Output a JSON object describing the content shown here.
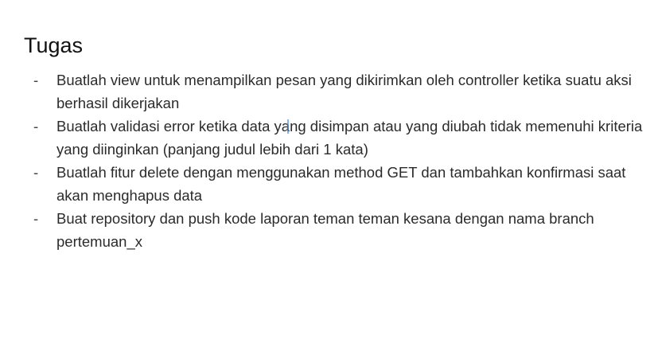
{
  "slide": {
    "title": "Tugas",
    "bullet_symbol": "-",
    "tasks": [
      {
        "text": "Buatlah view untuk menampilkan pesan yang dikirimkan oleh controller ketika suatu aksi berhasil dikerjakan"
      },
      {
        "text": "Buatlah validasi error ketika data yang disimpan atau yang diubah tidak memenuhi kriteria yang diinginkan (panjang judul lebih dari 1 kata)"
      },
      {
        "text": "Buatlah fitur delete dengan menggunakan method GET dan tambahkan konfirmasi saat akan menghapus data"
      },
      {
        "text": "Buat repository dan push kode laporan teman teman kesana dengan nama branch pertemuan_x"
      }
    ]
  },
  "colors": {
    "background": "#ffffff",
    "text": "#2b2b2b",
    "title": "#111111",
    "cursor": "#4a89dc"
  }
}
